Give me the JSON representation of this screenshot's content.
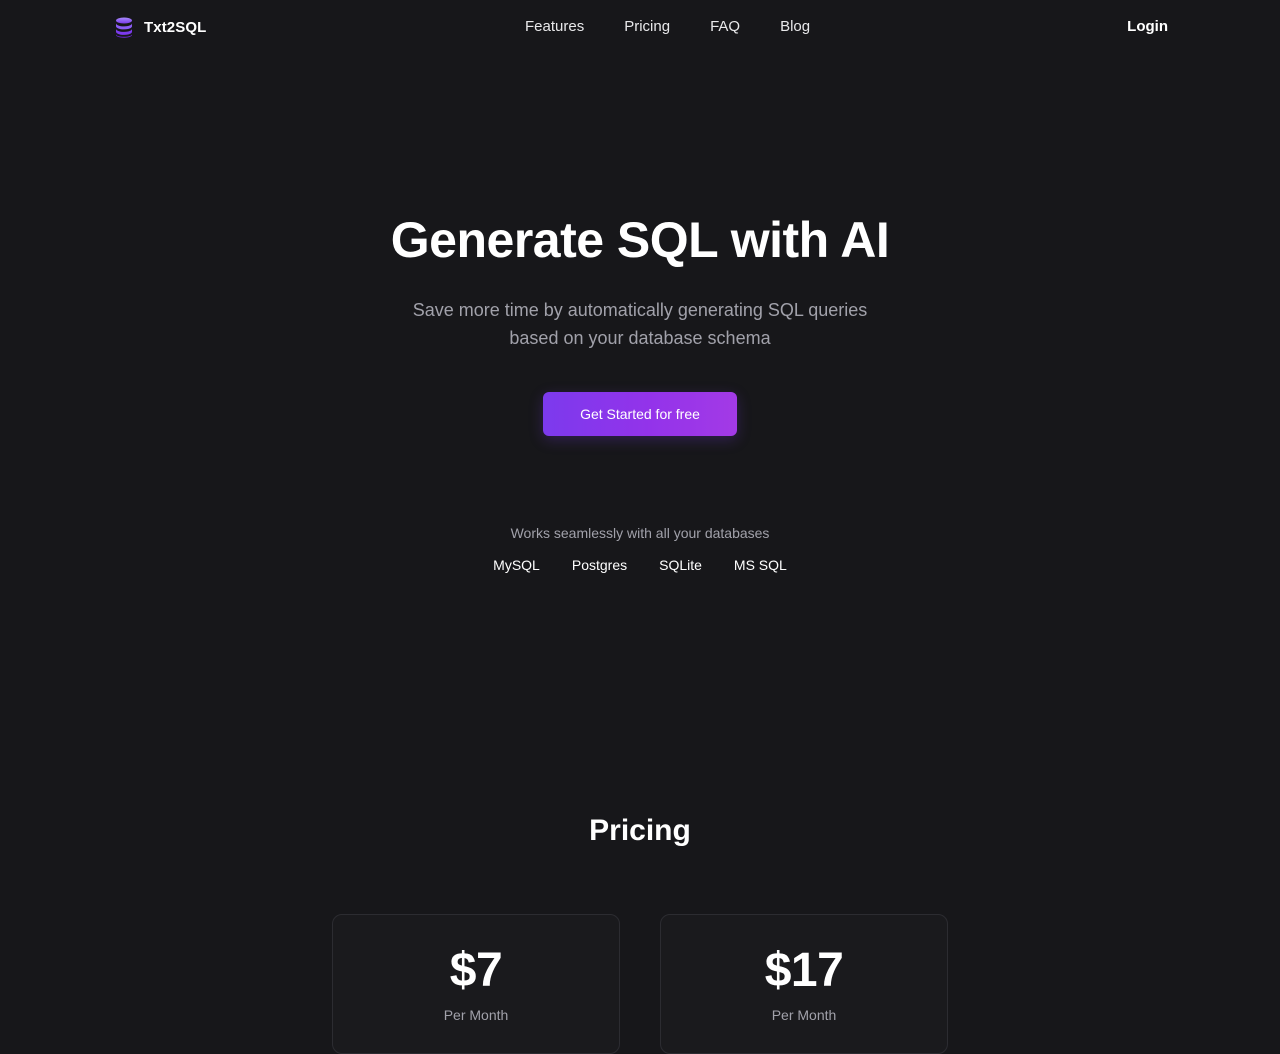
{
  "brand": {
    "name": "Txt2SQL",
    "icon": "database-icon",
    "icon_color": "#8b5cf6"
  },
  "nav": {
    "items": [
      {
        "label": "Features"
      },
      {
        "label": "Pricing"
      },
      {
        "label": "FAQ"
      },
      {
        "label": "Blog"
      }
    ],
    "login_label": "Login"
  },
  "hero": {
    "title": "Generate SQL with AI",
    "subtitle": "Save more time by automatically generating SQL queries based on your database schema",
    "cta_label": "Get Started for free"
  },
  "databases": {
    "caption": "Works seamlessly with all your databases",
    "items": [
      "MySQL",
      "Postgres",
      "SQLite",
      "MS SQL"
    ]
  },
  "pricing": {
    "title": "Pricing",
    "plans": [
      {
        "price": "$7",
        "period": "Per Month"
      },
      {
        "price": "$17",
        "period": "Per Month"
      }
    ]
  },
  "colors": {
    "background": "#17171a",
    "accent": "#9333ea",
    "muted_text": "#a1a1aa"
  }
}
